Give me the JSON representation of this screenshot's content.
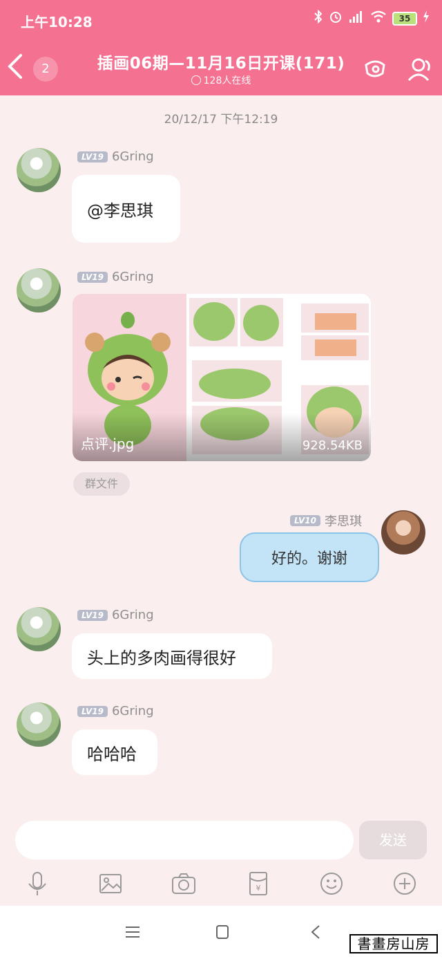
{
  "status_bar": {
    "time": "上午10:28",
    "battery": "35"
  },
  "header": {
    "unread_count": "2",
    "title": "插画06期—11月16日开课(171)",
    "online": "128人在线"
  },
  "timestamp": "20/12/17 下午12:19",
  "messages": [
    {
      "level": "LV19",
      "sender": "6Gring",
      "text": "@李思琪"
    },
    {
      "level": "LV19",
      "sender": "6Gring",
      "file_name": "点评.jpg",
      "file_size": "928.54KB",
      "tag": "群文件"
    },
    {
      "level": "LV10",
      "sender": "李思琪",
      "text": "好的。谢谢"
    },
    {
      "level": "LV19",
      "sender": "6Gring",
      "text": "头上的多肉画得很好"
    },
    {
      "level": "LV19",
      "sender": "6Gring",
      "text": "哈哈哈"
    }
  ],
  "composer": {
    "send_label": "发送"
  },
  "toolbar_icons": [
    "mic-icon",
    "image-icon",
    "camera-icon",
    "red-packet-icon",
    "emoji-icon",
    "plus-icon"
  ],
  "watermark": "書畫房山房",
  "colors": {
    "header": "#f47191",
    "background": "#fbeeee",
    "bubble": "#ffffff",
    "self_bubble": "#c3e3f7"
  }
}
